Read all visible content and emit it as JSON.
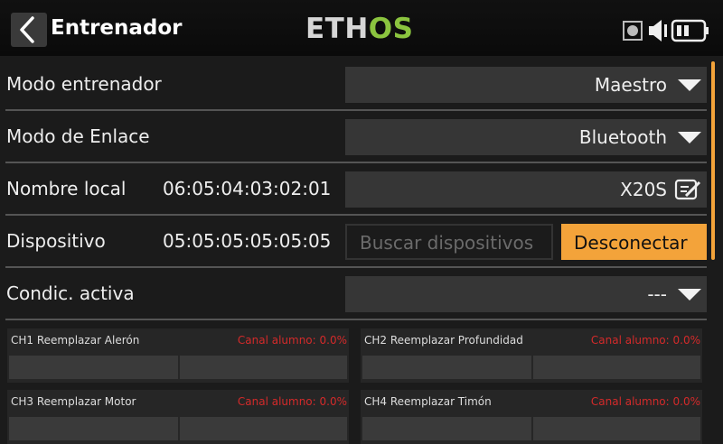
{
  "header": {
    "title": "Entrenador",
    "logo_part1": "ETH",
    "logo_part2": "OS",
    "colors": {
      "logo_accent": "#8bc43f",
      "accent": "#f3a33a"
    },
    "icons": [
      "back-chevron-icon",
      "record-indicator-icon",
      "speaker-icon",
      "battery-icon"
    ]
  },
  "rows": {
    "trainer_mode": {
      "label": "Modo entrenador",
      "value": "Maestro"
    },
    "link_mode": {
      "label": "Modo de Enlace",
      "value": "Bluetooth"
    },
    "local_name": {
      "label": "Nombre local",
      "address": "06:05:04:03:02:01",
      "value": "X20S"
    },
    "device": {
      "label": "Dispositivo",
      "address": "05:05:05:05:05:05",
      "search_label": "Buscar dispositivos",
      "disconnect_label": "Desconectar"
    },
    "active_condition": {
      "label": "Condic. activa",
      "value": "---"
    }
  },
  "channels": [
    {
      "title": "CH1 Reemplazar Alerón",
      "status": "Canal alumno: 0.0%",
      "value_percent": 0.0
    },
    {
      "title": "CH2 Reemplazar Profundidad",
      "status": "Canal alumno: 0.0%",
      "value_percent": 0.0
    },
    {
      "title": "CH3 Reemplazar Motor",
      "status": "Canal alumno: 0.0%",
      "value_percent": 0.0
    },
    {
      "title": "CH4 Reemplazar Timón",
      "status": "Canal alumno: 0.0%",
      "value_percent": 0.0
    }
  ]
}
